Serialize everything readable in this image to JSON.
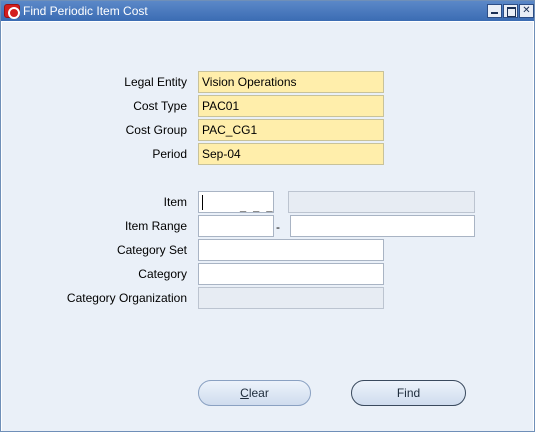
{
  "window": {
    "title": "Find Periodic Item Cost",
    "controls": {
      "minimize": "minimize",
      "maximize": "maximize",
      "close": "close"
    }
  },
  "form": {
    "legal_entity": {
      "label": "Legal Entity",
      "value": "Vision Operations"
    },
    "cost_type": {
      "label": "Cost Type",
      "value": "PAC01"
    },
    "cost_group": {
      "label": "Cost Group",
      "value": "PAC_CG1"
    },
    "period": {
      "label": "Period",
      "value": "Sep-04"
    },
    "item": {
      "label": "Item",
      "value": "",
      "segment_hint": "_ _ _",
      "description": ""
    },
    "item_range": {
      "label": "Item Range",
      "from": "",
      "separator": "-",
      "to": ""
    },
    "category_set": {
      "label": "Category Set",
      "value": ""
    },
    "category": {
      "label": "Category",
      "value": ""
    },
    "category_organization": {
      "label": "Category Organization",
      "value": ""
    }
  },
  "buttons": {
    "clear": {
      "mnemonic": "C",
      "rest": "lear"
    },
    "find": {
      "label": "Find"
    }
  },
  "colors": {
    "titlebar": "#3b6cb3",
    "readonly_field": "#ffeeab",
    "disabled_field": "#e7ecf3",
    "background": "#eaf0f8"
  }
}
